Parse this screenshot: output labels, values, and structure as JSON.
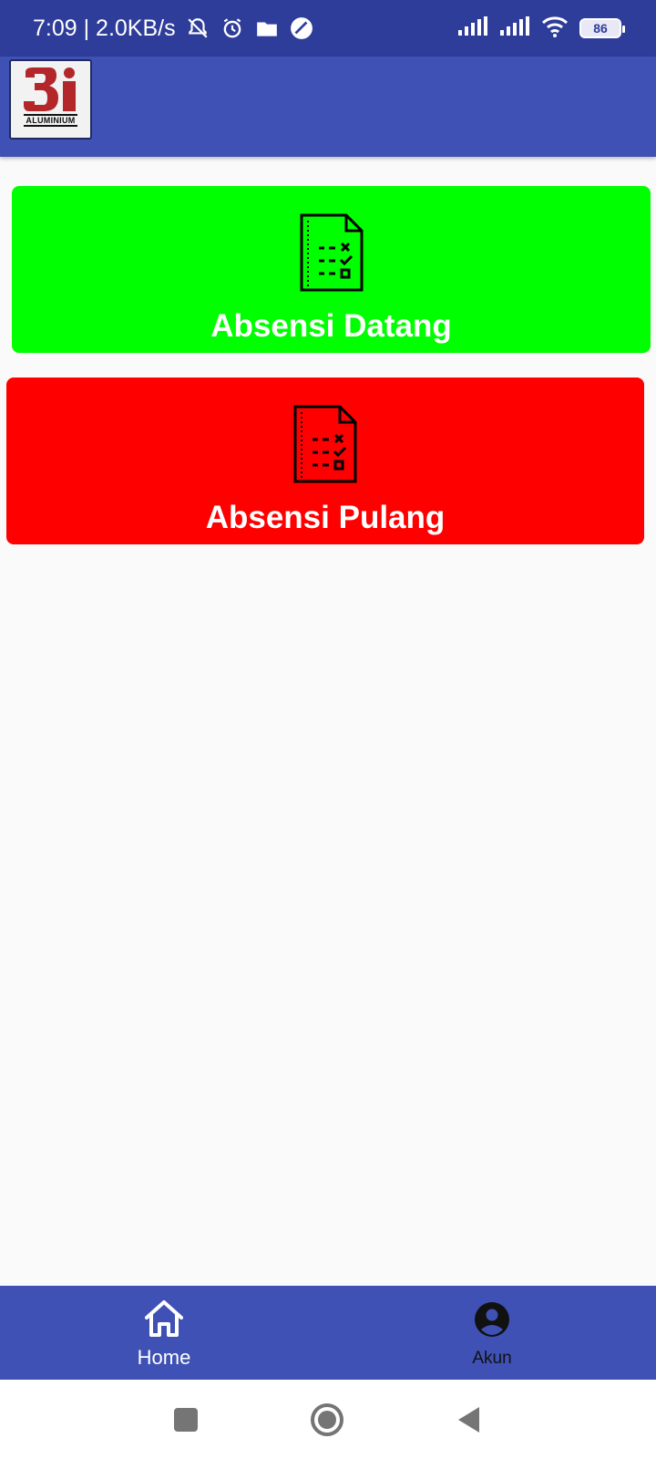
{
  "status_bar": {
    "time_speed": "7:09 | 2.0KB/s",
    "icons": [
      "notifications-off-icon",
      "alarm-icon",
      "folder-icon",
      "app-icon"
    ],
    "right_icons": [
      "signal-icon",
      "signal-icon",
      "wifi-icon"
    ],
    "battery_level": "86"
  },
  "app_bar": {
    "logo_mark": "3i",
    "logo_text": "ALUMINIUM"
  },
  "cards": [
    {
      "label": "Absensi Datang",
      "color": "#00ff00",
      "icon": "checklist-document-icon"
    },
    {
      "label": "Absensi Pulang",
      "color": "#ff0000",
      "icon": "checklist-document-icon"
    }
  ],
  "bottom_nav": {
    "home_label": "Home",
    "akun_label": "Akun"
  },
  "colors": {
    "status_bar": "#2f3d9a",
    "primary": "#3f51b5",
    "background": "#fafafa",
    "logo_red": "#b3262a"
  }
}
